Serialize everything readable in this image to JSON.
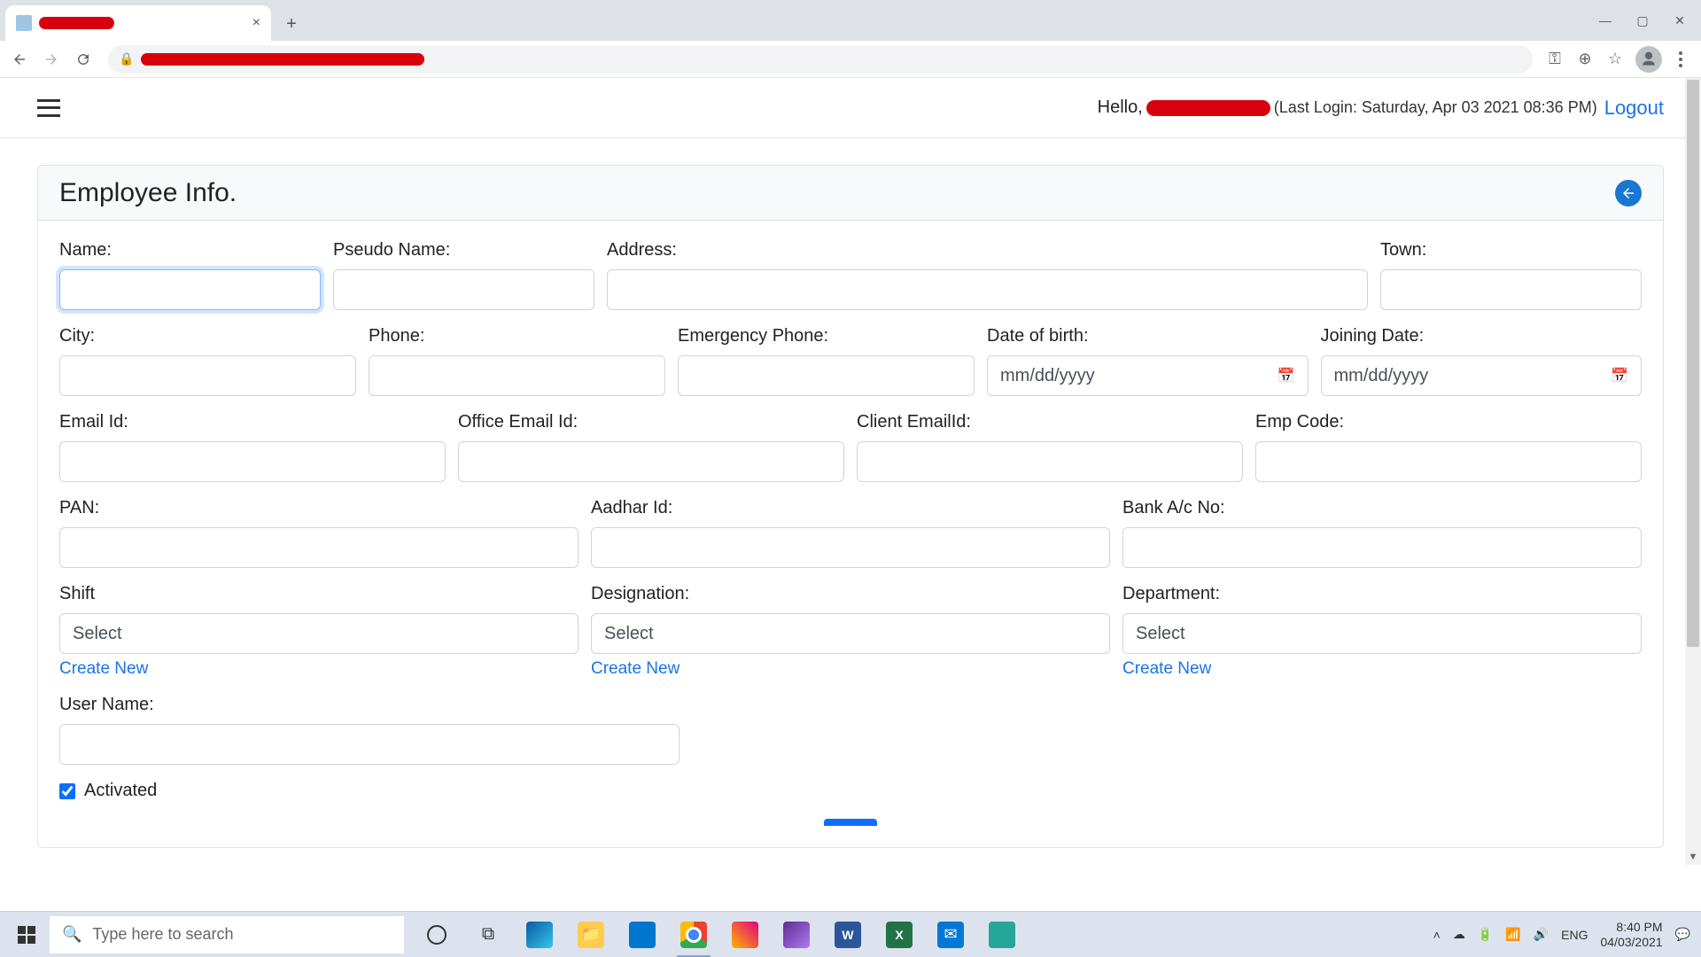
{
  "browser": {
    "tab_close": "×",
    "newtab": "+",
    "win_min": "—",
    "win_max": "▢",
    "win_close": "✕"
  },
  "header": {
    "hello_prefix": "Hello,",
    "last_login": "(Last Login: Saturday, Apr 03 2021 08:36 PM)",
    "logout": "Logout"
  },
  "card": {
    "title": "Employee Info."
  },
  "fields": {
    "name": "Name:",
    "pseudo": "Pseudo Name:",
    "address": "Address:",
    "town": "Town:",
    "city": "City:",
    "phone": "Phone:",
    "emergency_phone": "Emergency Phone:",
    "dob": "Date of birth:",
    "joining": "Joining Date:",
    "email": "Email Id:",
    "office_email": "Office Email Id:",
    "client_email": "Client EmailId:",
    "emp_code": "Emp Code:",
    "pan": "PAN:",
    "aadhar": "Aadhar Id:",
    "bank": "Bank A/c No:",
    "shift": "Shift",
    "designation": "Designation:",
    "department": "Department:",
    "username": "User Name:",
    "activated": "Activated"
  },
  "select_default": "Select",
  "date_placeholder": "mm/dd/yyyy",
  "links": {
    "create_new": "Create New"
  },
  "taskbar": {
    "search_placeholder": "Type here to search",
    "lang": "ENG",
    "time": "8:40 PM",
    "date": "04/03/2021",
    "word": "W",
    "excel": "X"
  }
}
